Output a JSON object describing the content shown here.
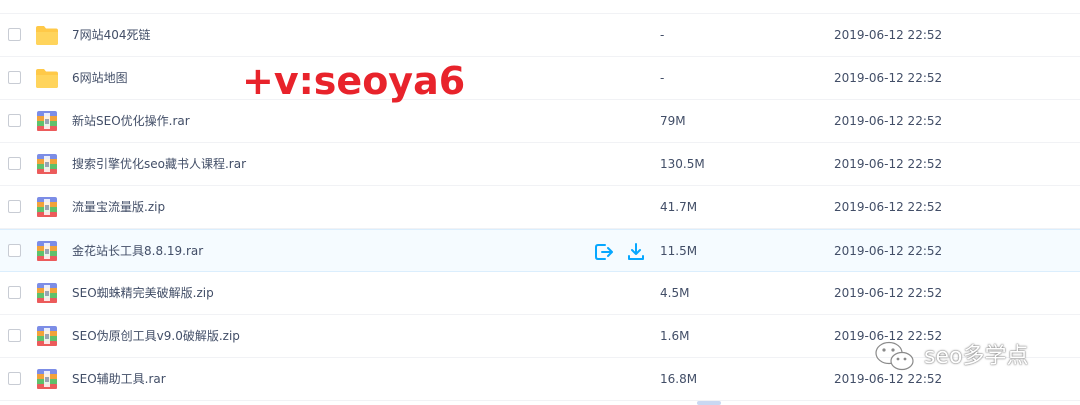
{
  "files": [
    {
      "name": "7网站404死链",
      "size": "-",
      "date": "2019-06-12 22:52",
      "type": "folder"
    },
    {
      "name": "6网站地图",
      "size": "-",
      "date": "2019-06-12 22:52",
      "type": "folder"
    },
    {
      "name": "新站SEO优化操作.rar",
      "size": "79M",
      "date": "2019-06-12 22:52",
      "type": "archive"
    },
    {
      "name": "搜索引擎优化seo藏书人课程.rar",
      "size": "130.5M",
      "date": "2019-06-12 22:52",
      "type": "archive"
    },
    {
      "name": "流量宝流量版.zip",
      "size": "41.7M",
      "date": "2019-06-12 22:52",
      "type": "archive"
    },
    {
      "name": "金花站长工具8.8.19.rar",
      "size": "11.5M",
      "date": "2019-06-12 22:52",
      "type": "archive"
    },
    {
      "name": "SEO蜘蛛精完美破解版.zip",
      "size": "4.5M",
      "date": "2019-06-12 22:52",
      "type": "archive"
    },
    {
      "name": "SEO伪原创工具v9.0破解版.zip",
      "size": "1.6M",
      "date": "2019-06-12 22:52",
      "type": "archive"
    },
    {
      "name": "SEO辅助工具.rar",
      "size": "16.8M",
      "date": "2019-06-12 22:52",
      "type": "archive"
    }
  ],
  "hovered_row": 5,
  "row_actions": {
    "share_icon": "share-icon",
    "download_icon": "download-icon"
  },
  "watermark_text": "+v:seoya6",
  "badge": {
    "icon": "wechat-icon",
    "text": "seo多学点"
  },
  "colors": {
    "accent": "#06a7ff",
    "watermark": "#e8232b",
    "folder": "#ffc948"
  }
}
